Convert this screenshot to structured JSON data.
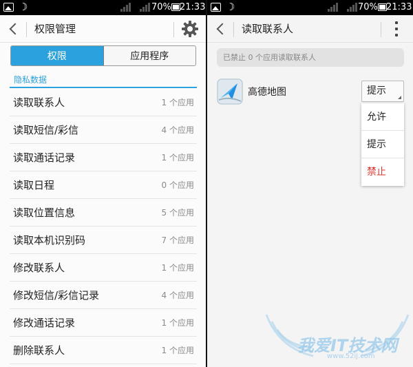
{
  "status_bar": {
    "battery_percent": "70%",
    "time": "21:33"
  },
  "left": {
    "title": "权限管理",
    "tabs": [
      {
        "label": "权限",
        "active": true
      },
      {
        "label": "应用程序",
        "active": false
      }
    ],
    "section_header": "隐私数据",
    "permissions": [
      {
        "name": "读取联系人",
        "count": "1 个应用"
      },
      {
        "name": "读取短信/彩信",
        "count": "4 个应用"
      },
      {
        "name": "读取通话记录",
        "count": "1 个应用"
      },
      {
        "name": "读取日程",
        "count": "0 个应用"
      },
      {
        "name": "读取位置信息",
        "count": "5 个应用"
      },
      {
        "name": "读取本机识别码",
        "count": "7 个应用"
      },
      {
        "name": "修改联系人",
        "count": "1 个应用"
      },
      {
        "name": "修改短信/彩信记录",
        "count": "4 个应用"
      },
      {
        "name": "修改通话记录",
        "count": "1 个应用"
      },
      {
        "name": "删除联系人",
        "count": "1 个应用"
      }
    ]
  },
  "right": {
    "title": "读取联系人",
    "notice": "已禁止 0 个应用读取联系人",
    "app": {
      "name": "高德地图",
      "icon": "navigation-arrow-icon"
    },
    "dropdown": {
      "selected": "提示",
      "options": [
        "允许",
        "提示",
        "禁止"
      ]
    }
  },
  "watermark": {
    "text": "我爱IT技术网",
    "url": "www.52ij.com"
  },
  "colors": {
    "accent": "#2ba2dd",
    "danger": "#d9362d"
  }
}
